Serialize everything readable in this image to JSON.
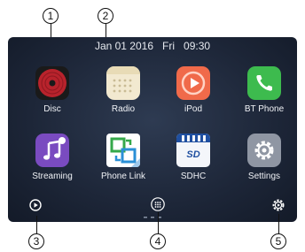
{
  "callouts": [
    "1",
    "2",
    "3",
    "4",
    "5"
  ],
  "status": {
    "date": "Jan 01 2016",
    "day": "Fri",
    "time": "09:30"
  },
  "apps": [
    {
      "label": "Disc",
      "icon": "disc-icon"
    },
    {
      "label": "Radio",
      "icon": "radio-icon"
    },
    {
      "label": "iPod",
      "icon": "ipod-icon"
    },
    {
      "label": "BT Phone",
      "icon": "phone-icon"
    },
    {
      "label": "Streaming",
      "icon": "music-note-icon"
    },
    {
      "label": "Phone Link",
      "icon": "phone-link-icon"
    },
    {
      "label": "SDHC",
      "icon": "sd-card-icon"
    },
    {
      "label": "Settings",
      "icon": "gear-icon"
    }
  ],
  "dock": {
    "left_icon": "play-circle-icon",
    "center_icon": "app-grid-icon",
    "right_icon": "settings-gear-icon"
  },
  "colors": {
    "screen_bg": "#1d2638",
    "disc": "#c8252f",
    "ipod": "#f06a4a",
    "phone": "#3dbb4e",
    "streaming": "#7a4bc0",
    "phone_link": "#2a8fd6",
    "sdhc": "#1f4fa0",
    "settings": "#8f96a3"
  }
}
